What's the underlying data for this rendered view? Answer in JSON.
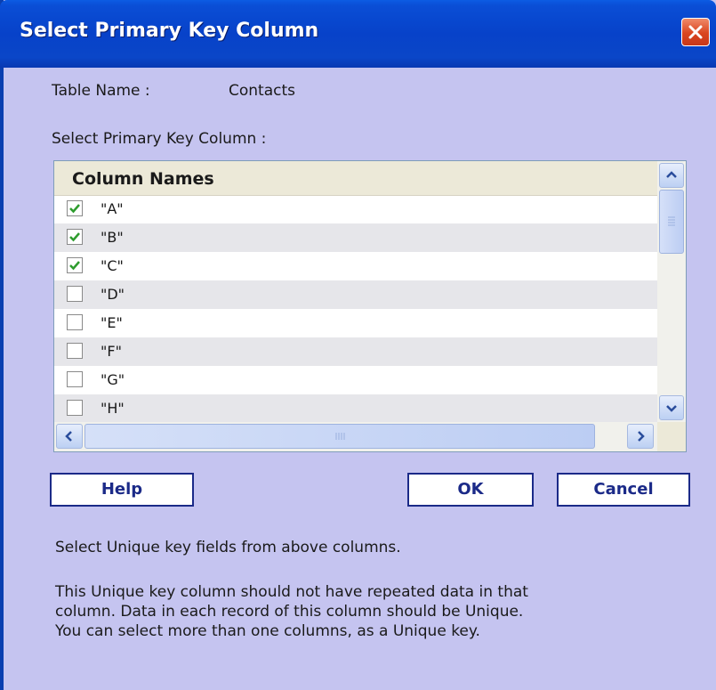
{
  "window": {
    "title": "Select Primary Key Column",
    "close_icon": "close-icon"
  },
  "form": {
    "table_name_label": "Table Name :",
    "table_name_value": "Contacts",
    "select_label": "Select Primary Key Column :"
  },
  "grid": {
    "header": "Column Names",
    "rows": [
      {
        "label": "\"A\"",
        "checked": true
      },
      {
        "label": "\"B\"",
        "checked": true
      },
      {
        "label": "\"C\"",
        "checked": true
      },
      {
        "label": "\"D\"",
        "checked": false
      },
      {
        "label": "\"E\"",
        "checked": false
      },
      {
        "label": "\"F\"",
        "checked": false
      },
      {
        "label": "\"G\"",
        "checked": false
      },
      {
        "label": "\"H\"",
        "checked": false
      }
    ]
  },
  "buttons": {
    "help": "Help",
    "ok": "OK",
    "cancel": "Cancel"
  },
  "info": {
    "line1": "Select Unique key fields from above columns.",
    "para": [
      "This Unique key column should not have repeated data in that",
      "column. Data in each record of this column should be Unique.",
      "You can select more than one columns, as a Unique key."
    ]
  },
  "colors": {
    "dialog_bg": "#c5c4f0",
    "titlebar": "#0742c9",
    "check": "#2e9c2e",
    "button_border": "#1b2a88"
  }
}
